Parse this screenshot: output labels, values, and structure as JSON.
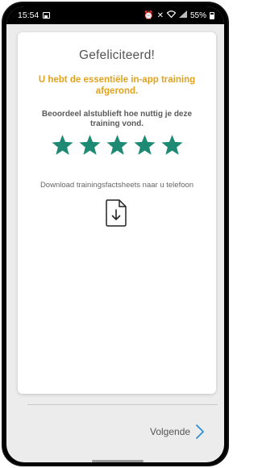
{
  "status_bar": {
    "time": "15:54",
    "battery": "55%"
  },
  "card": {
    "title": "Gefeliciteerd!",
    "subtitle": "U hebt de essentiële in-app training afgerond.",
    "rating_prompt": "Beoordeel alstublieft hoe nuttig je deze training vond.",
    "rating": {
      "stars_total": 5,
      "stars_filled": 5
    },
    "download_text": "Download trainingsfactsheets naar u telefoon",
    "download_icon": "document-download-icon"
  },
  "footer": {
    "next_label": "Volgende",
    "next_icon": "chevron-right-icon"
  },
  "colors": {
    "accent_orange": "#e2a21b",
    "star_green": "#1e8a73",
    "chevron_blue": "#2f8fd8",
    "background": "#ececec"
  }
}
